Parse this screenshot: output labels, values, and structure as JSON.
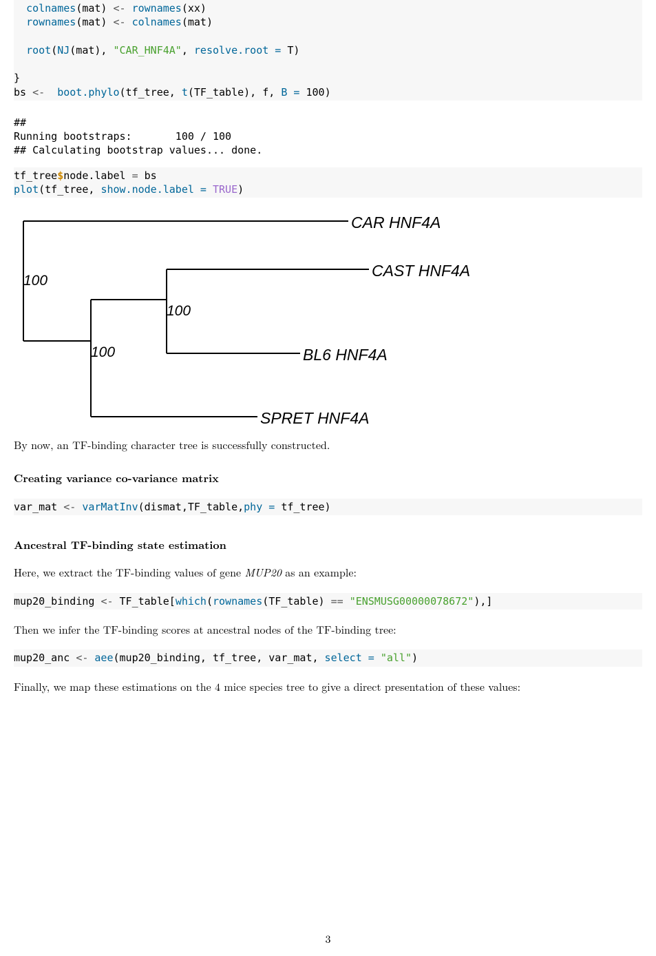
{
  "code_block_1_lines": [
    "  <span class='fn'>colnames</span>(mat) <span class='rarr'>&lt;-</span> <span class='fn'>rownames</span>(xx)",
    "  <span class='fn'>rownames</span>(mat) <span class='rarr'>&lt;-</span> <span class='fn'>colnames</span>(mat)",
    "",
    "  <span class='fn'>root</span>(<span class='fn'>NJ</span>(mat), <span class='str'>\"CAR_HNF4A\"</span>, <span class='arg'>resolve.root =</span> T)",
    "",
    "}",
    "bs <span class='rarr'>&lt;-</span>  <span class='fn'>boot.phylo</span>(tf_tree, <span class='fn'>t</span>(TF_table), f, <span class='arg'>B =</span> <span class='num'>100</span>)"
  ],
  "output_block_1_lines": [
    "##",
    "Running bootstraps:       100 / 100",
    "## Calculating bootstrap values... done."
  ],
  "code_block_2_lines": [
    "tf_tree<span class='dollar'>$</span>node.label <span class='rarr'>=</span> bs",
    "<span class='fn'>plot</span>(tf_tree, <span class='arg'>show.node.label =</span> <span class='bool'>TRUE</span>)"
  ],
  "chart_data": {
    "type": "table",
    "title": "TF-binding character tree (NJ, rooted on CAR_HNF4A) with bootstrap node labels",
    "tips": [
      "CAR HNF4A",
      "CAST HNF4A",
      "BL6 HNF4A",
      "SPRET HNF4A"
    ],
    "node_labels": [
      100,
      100,
      100
    ],
    "topology": "((CAST HNF4A, BL6 HNF4A)100, SPRET HNF4A)100, CAR HNF4A)100;"
  },
  "tree": {
    "tips": {
      "car": "CAR HNF4A",
      "cast": "CAST HNF4A",
      "bl6": "BL6 HNF4A",
      "spret": "SPRET HNF4A"
    },
    "nodes": {
      "root": "100",
      "n1": "100",
      "n2": "100"
    }
  },
  "prose_after_tree": "By now, an TF-binding character tree is successfully constructed.",
  "heading_varcov": "Creating variance co-variance matrix",
  "code_block_3_lines": [
    "var_mat <span class='rarr'>&lt;-</span> <span class='fn'>varMatInv</span>(dismat,TF_table,<span class='arg'>phy =</span> tf_tree)"
  ],
  "heading_anc": "Ancestral TF-binding state estimation",
  "prose_anc_intro_prefix": "Here, we extract the TF-binding values of gene ",
  "prose_anc_intro_gene": "MUP20",
  "prose_anc_intro_suffix": " as an example:",
  "code_block_4_lines": [
    "mup20_binding <span class='rarr'>&lt;-</span> TF_table[<span class='fn'>which</span>(<span class='fn'>rownames</span>(TF_table) <span class='rarr'>==</span> <span class='str'>\"ENSMUSG00000078672\"</span>),]"
  ],
  "prose_infer": "Then we infer the TF-binding scores at ancestral nodes of the TF-binding tree:",
  "code_block_5_lines": [
    "mup20_anc <span class='rarr'>&lt;-</span> <span class='fn'>aee</span>(mup20_binding, tf_tree, var_mat, <span class='arg'>select =</span> <span class='str'>\"all\"</span>)"
  ],
  "prose_final": "Finally, we map these estimations on the 4 mice species tree to give a direct presentation of these values:",
  "page_number": "3"
}
